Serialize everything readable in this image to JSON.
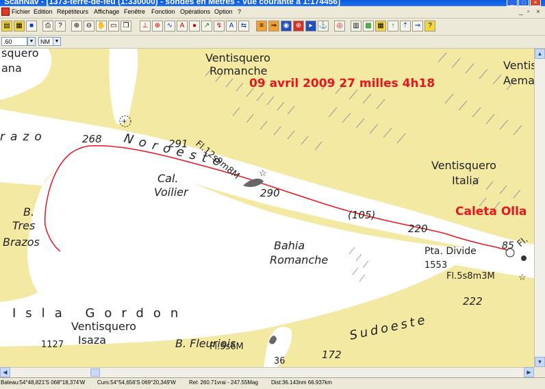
{
  "window": {
    "title": "ScanNav - [1373-terre-de-feu (1:330000) - sondes en Mètres - Vue courante à 1:174456]"
  },
  "menu": {
    "items": [
      "Fichier",
      "Edition",
      "Répétiteurs",
      "Affichage",
      "Fenêtre",
      "Fonction",
      "Opérations",
      "Option",
      "?"
    ]
  },
  "toolbar": {
    "scale_value": ".60",
    "unit_value": "NM"
  },
  "map": {
    "colors": {
      "land": "#f3e9a2",
      "water": "#ffffff",
      "track": "#e8141e",
      "annotation": "#e8141e"
    },
    "annotations": {
      "date_log": "09 avril 2009 27 milles 4h18",
      "destination": "Caleta Olla"
    },
    "labels": {
      "ventisquero_romanche_1": "Ventisquero",
      "ventisquero_romanche_2": "Romanche",
      "ventisquero_top_right_1": "Ventisc",
      "ventisquero_top_right_2": "Aema",
      "ventisquero_italia_1": "Ventisquero",
      "ventisquero_italia_2": "Italia",
      "glacier_top_left_1": "squero",
      "glacier_top_left_2": "ana",
      "brazo_left": "razo",
      "noroeste": "Noroeste",
      "cal_voilier_1": "Cal.",
      "cal_voilier_2": "Voilier",
      "tres_brazos_1": "B.",
      "tres_brazos_2": "Tres",
      "tres_brazos_3": "Brazos",
      "bahia_romanche_1": "Bahia",
      "bahia_romanche_2": "Romanche",
      "pta_divide": "Pta. Divide",
      "isla_gordon": "Isla Gordon",
      "ventisquero_isaza_1": "Ventisquero",
      "ventisquero_isaza_2": "Isaza",
      "b_fleuriais": "B. Fleuriais",
      "sudoeste": "Sudoeste",
      "fl_right_edge": "Fl."
    },
    "lights": {
      "fl_noroeste": "Fl.12s9m8M",
      "fl_divide": "Fl.5s8m3M",
      "fl_fleuriais": "Fl.5s6M"
    },
    "soundings": {
      "s268": "268",
      "s291": "291",
      "s290": "290",
      "s105": "(105)",
      "s220": "220",
      "s85": "85",
      "s222": "222",
      "s1553": "1553",
      "s1127": "1127",
      "s172": "172",
      "s36": "36"
    }
  },
  "status": {
    "bateau": "Bateau:54°48,821'S 068°18,374'W",
    "curseur": "Curs:54°54,656'S 069°20,349'W",
    "relevement": "Rel: 260.71vrai - 247.55Mag",
    "distance": "Dist:36.143nm  66.937km"
  }
}
